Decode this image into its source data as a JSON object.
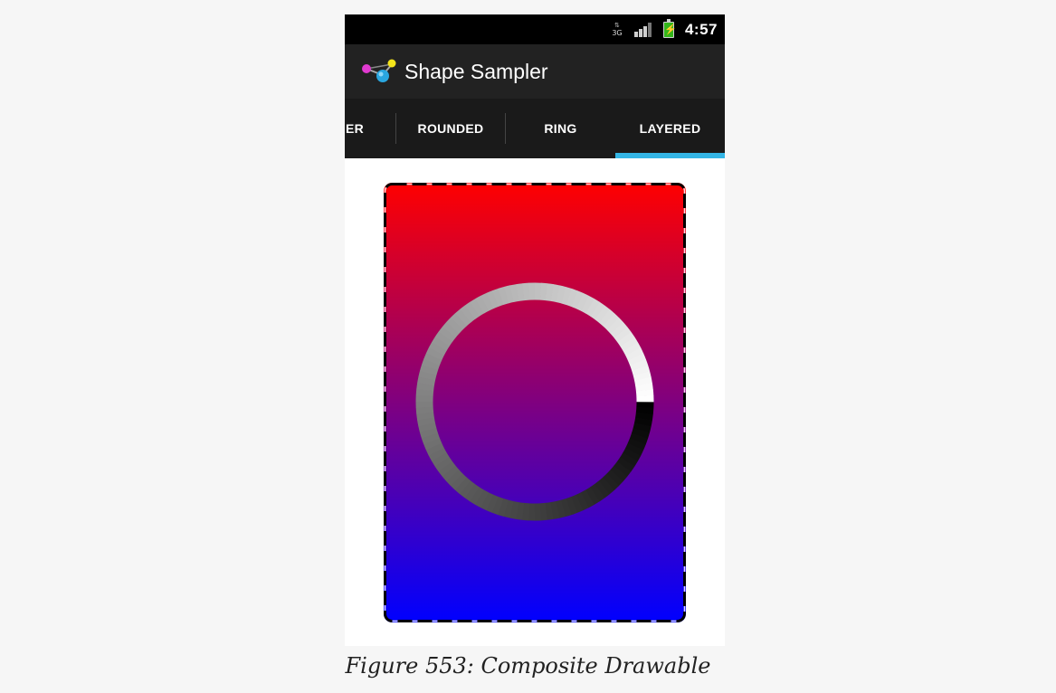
{
  "status_bar": {
    "network_label": "3G",
    "time": "4:57",
    "icons": [
      "network-3g-icon",
      "signal-strength-icon",
      "battery-charging-icon"
    ]
  },
  "action_bar": {
    "app_icon": "shape-sampler-app-icon",
    "title": "Shape Sampler"
  },
  "tabs": {
    "items": [
      {
        "label": "ER"
      },
      {
        "label": "ROUNDED"
      },
      {
        "label": "RING"
      },
      {
        "label": "LAYERED"
      }
    ],
    "selected_label": "LAYERED",
    "indicator_color": "#33b5e5"
  },
  "drawable": {
    "gradient_top_color": "#ff0000",
    "gradient_bottom_color": "#0000ff",
    "border_color": "#000000",
    "border_style": "dashed",
    "ring_gradient_start": "#000000",
    "ring_gradient_end": "#ffffff"
  },
  "caption": "Figure 553: Composite Drawable"
}
